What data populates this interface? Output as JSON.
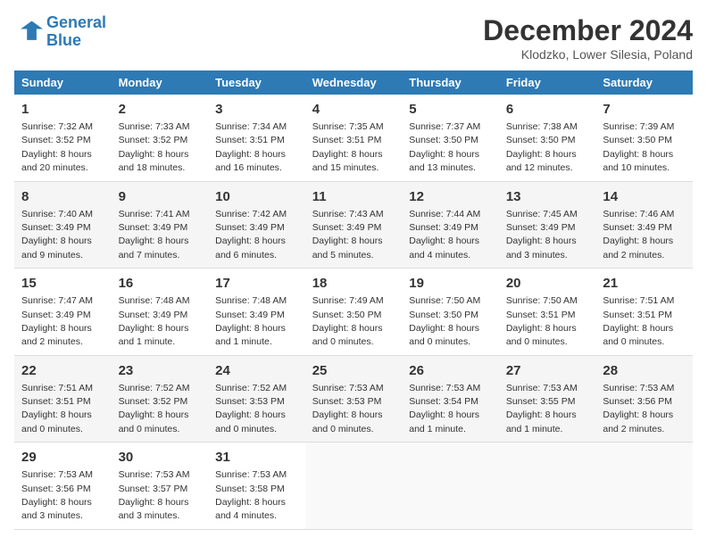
{
  "header": {
    "logo_line1": "General",
    "logo_line2": "Blue",
    "month": "December 2024",
    "location": "Klodzko, Lower Silesia, Poland"
  },
  "days_of_week": [
    "Sunday",
    "Monday",
    "Tuesday",
    "Wednesday",
    "Thursday",
    "Friday",
    "Saturday"
  ],
  "weeks": [
    [
      {
        "day": "1",
        "info": "Sunrise: 7:32 AM\nSunset: 3:52 PM\nDaylight: 8 hours\nand 20 minutes."
      },
      {
        "day": "2",
        "info": "Sunrise: 7:33 AM\nSunset: 3:52 PM\nDaylight: 8 hours\nand 18 minutes."
      },
      {
        "day": "3",
        "info": "Sunrise: 7:34 AM\nSunset: 3:51 PM\nDaylight: 8 hours\nand 16 minutes."
      },
      {
        "day": "4",
        "info": "Sunrise: 7:35 AM\nSunset: 3:51 PM\nDaylight: 8 hours\nand 15 minutes."
      },
      {
        "day": "5",
        "info": "Sunrise: 7:37 AM\nSunset: 3:50 PM\nDaylight: 8 hours\nand 13 minutes."
      },
      {
        "day": "6",
        "info": "Sunrise: 7:38 AM\nSunset: 3:50 PM\nDaylight: 8 hours\nand 12 minutes."
      },
      {
        "day": "7",
        "info": "Sunrise: 7:39 AM\nSunset: 3:50 PM\nDaylight: 8 hours\nand 10 minutes."
      }
    ],
    [
      {
        "day": "8",
        "info": "Sunrise: 7:40 AM\nSunset: 3:49 PM\nDaylight: 8 hours\nand 9 minutes."
      },
      {
        "day": "9",
        "info": "Sunrise: 7:41 AM\nSunset: 3:49 PM\nDaylight: 8 hours\nand 7 minutes."
      },
      {
        "day": "10",
        "info": "Sunrise: 7:42 AM\nSunset: 3:49 PM\nDaylight: 8 hours\nand 6 minutes."
      },
      {
        "day": "11",
        "info": "Sunrise: 7:43 AM\nSunset: 3:49 PM\nDaylight: 8 hours\nand 5 minutes."
      },
      {
        "day": "12",
        "info": "Sunrise: 7:44 AM\nSunset: 3:49 PM\nDaylight: 8 hours\nand 4 minutes."
      },
      {
        "day": "13",
        "info": "Sunrise: 7:45 AM\nSunset: 3:49 PM\nDaylight: 8 hours\nand 3 minutes."
      },
      {
        "day": "14",
        "info": "Sunrise: 7:46 AM\nSunset: 3:49 PM\nDaylight: 8 hours\nand 2 minutes."
      }
    ],
    [
      {
        "day": "15",
        "info": "Sunrise: 7:47 AM\nSunset: 3:49 PM\nDaylight: 8 hours\nand 2 minutes."
      },
      {
        "day": "16",
        "info": "Sunrise: 7:48 AM\nSunset: 3:49 PM\nDaylight: 8 hours\nand 1 minute."
      },
      {
        "day": "17",
        "info": "Sunrise: 7:48 AM\nSunset: 3:49 PM\nDaylight: 8 hours\nand 1 minute."
      },
      {
        "day": "18",
        "info": "Sunrise: 7:49 AM\nSunset: 3:50 PM\nDaylight: 8 hours\nand 0 minutes."
      },
      {
        "day": "19",
        "info": "Sunrise: 7:50 AM\nSunset: 3:50 PM\nDaylight: 8 hours\nand 0 minutes."
      },
      {
        "day": "20",
        "info": "Sunrise: 7:50 AM\nSunset: 3:51 PM\nDaylight: 8 hours\nand 0 minutes."
      },
      {
        "day": "21",
        "info": "Sunrise: 7:51 AM\nSunset: 3:51 PM\nDaylight: 8 hours\nand 0 minutes."
      }
    ],
    [
      {
        "day": "22",
        "info": "Sunrise: 7:51 AM\nSunset: 3:51 PM\nDaylight: 8 hours\nand 0 minutes."
      },
      {
        "day": "23",
        "info": "Sunrise: 7:52 AM\nSunset: 3:52 PM\nDaylight: 8 hours\nand 0 minutes."
      },
      {
        "day": "24",
        "info": "Sunrise: 7:52 AM\nSunset: 3:53 PM\nDaylight: 8 hours\nand 0 minutes."
      },
      {
        "day": "25",
        "info": "Sunrise: 7:53 AM\nSunset: 3:53 PM\nDaylight: 8 hours\nand 0 minutes."
      },
      {
        "day": "26",
        "info": "Sunrise: 7:53 AM\nSunset: 3:54 PM\nDaylight: 8 hours\nand 1 minute."
      },
      {
        "day": "27",
        "info": "Sunrise: 7:53 AM\nSunset: 3:55 PM\nDaylight: 8 hours\nand 1 minute."
      },
      {
        "day": "28",
        "info": "Sunrise: 7:53 AM\nSunset: 3:56 PM\nDaylight: 8 hours\nand 2 minutes."
      }
    ],
    [
      {
        "day": "29",
        "info": "Sunrise: 7:53 AM\nSunset: 3:56 PM\nDaylight: 8 hours\nand 3 minutes."
      },
      {
        "day": "30",
        "info": "Sunrise: 7:53 AM\nSunset: 3:57 PM\nDaylight: 8 hours\nand 3 minutes."
      },
      {
        "day": "31",
        "info": "Sunrise: 7:53 AM\nSunset: 3:58 PM\nDaylight: 8 hours\nand 4 minutes."
      },
      null,
      null,
      null,
      null
    ]
  ]
}
